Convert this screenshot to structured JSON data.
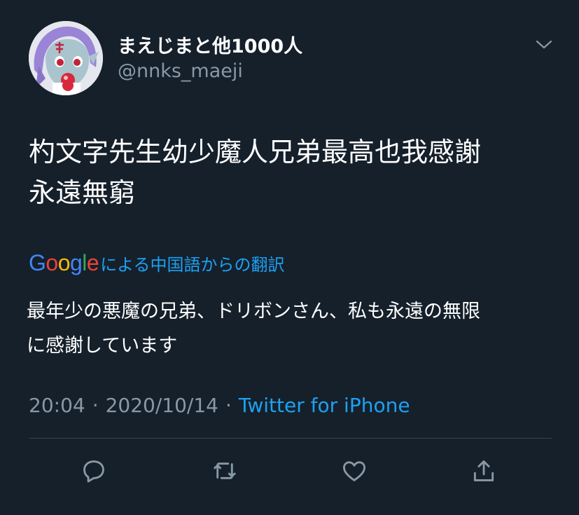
{
  "tweet": {
    "display_name": "まえじまと他1000人",
    "handle": "@nnks_maeji",
    "text_lines": [
      "杓文字先生幼少魔人兄弟最高也我感謝",
      "永遠無窮"
    ],
    "translation_brand": "Google",
    "translation_note": "による中国語からの翻訳",
    "translated_lines": [
      "最年少の悪魔の兄弟、ドリボンさん、私も永遠の無限",
      "に感謝しています"
    ],
    "time": "20:04",
    "date": "2020/10/14",
    "separator": "·",
    "source": "Twitter for iPhone"
  },
  "google_letters": [
    {
      "ch": "G",
      "color": "#4285F4"
    },
    {
      "ch": "o",
      "color": "#EA4335"
    },
    {
      "ch": "o",
      "color": "#FBBC05"
    },
    {
      "ch": "g",
      "color": "#4285F4"
    },
    {
      "ch": "l",
      "color": "#34A853"
    },
    {
      "ch": "e",
      "color": "#EA4335"
    }
  ],
  "actions": [
    {
      "name": "reply-button",
      "icon": "reply-icon"
    },
    {
      "name": "retweet-button",
      "icon": "retweet-icon"
    },
    {
      "name": "like-button",
      "icon": "heart-icon"
    },
    {
      "name": "share-button",
      "icon": "share-icon"
    }
  ],
  "colors": {
    "background": "#15202b",
    "primary_text": "#ffffff",
    "secondary_text": "#8899a6",
    "accent": "#1da1f2",
    "divider": "#38444d"
  }
}
